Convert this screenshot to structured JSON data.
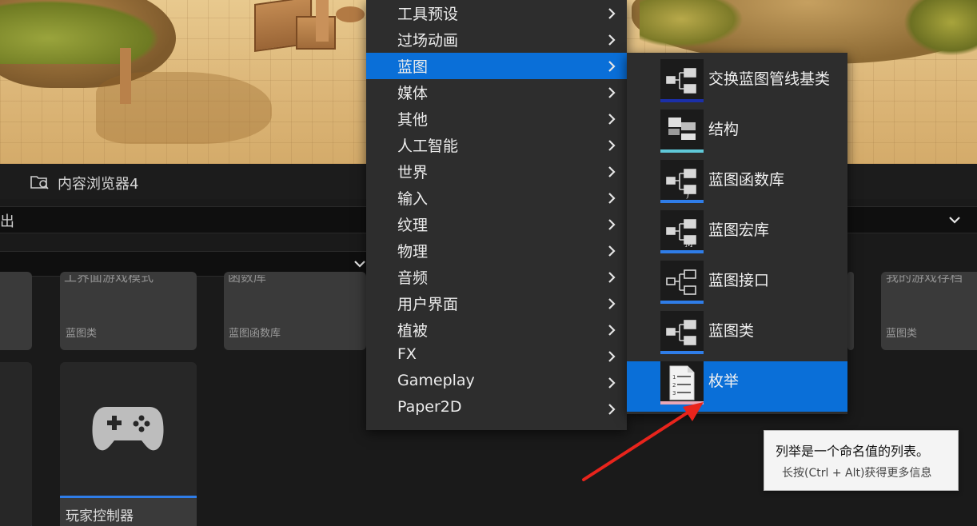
{
  "panel": {
    "tab_title": "内容浏览器4",
    "path_text": "出"
  },
  "assets": {
    "row1": [
      {
        "cut_name": "",
        "type_label": ""
      },
      {
        "cut_name": "工界面游戏模式",
        "type_label": "蓝图类"
      },
      {
        "cut_name": "函数库",
        "type_label": "蓝图函数库"
      },
      {
        "cut_name": "我的游戏存档",
        "type_label": "蓝图类"
      }
    ],
    "player_controller": {
      "name": "玩家控制器",
      "icon": "gamepad-icon"
    }
  },
  "menu": {
    "items": [
      {
        "label": "工具预设",
        "active": false
      },
      {
        "label": "过场动画",
        "active": false
      },
      {
        "label": "蓝图",
        "active": true
      },
      {
        "label": "媒体",
        "active": false
      },
      {
        "label": "其他",
        "active": false
      },
      {
        "label": "人工智能",
        "active": false
      },
      {
        "label": "世界",
        "active": false
      },
      {
        "label": "输入",
        "active": false
      },
      {
        "label": "纹理",
        "active": false
      },
      {
        "label": "物理",
        "active": false
      },
      {
        "label": "音频",
        "active": false
      },
      {
        "label": "用户界面",
        "active": false
      },
      {
        "label": "植被",
        "active": false
      },
      {
        "label": "FX",
        "active": false
      },
      {
        "label": "Gameplay",
        "active": false
      },
      {
        "label": "Paper2D",
        "active": false
      }
    ]
  },
  "submenu": {
    "items": [
      {
        "label": "交换蓝图管线基类",
        "icon": "blueprint-node-icon",
        "bar_color": "#1b2fa8",
        "active": false
      },
      {
        "label": "结构",
        "icon": "struct-icon",
        "bar_color": "#5fc8d8",
        "active": false
      },
      {
        "label": "蓝图函数库",
        "icon": "function-library-icon",
        "bar_color": "#2f7de8",
        "active": false
      },
      {
        "label": "蓝图宏库",
        "icon": "macro-library-icon",
        "bar_color": "#2f7de8",
        "active": false
      },
      {
        "label": "蓝图接口",
        "icon": "interface-icon",
        "bar_color": "#2f7de8",
        "active": false
      },
      {
        "label": "蓝图类",
        "icon": "blueprint-class-icon",
        "bar_color": "#2f7de8",
        "active": false
      },
      {
        "label": "枚举",
        "icon": "enum-icon",
        "bar_color": "#e8a8b8",
        "active": true
      }
    ]
  },
  "tooltip": {
    "title": "列举是一个命名值的列表。",
    "hint": "长按(Ctrl + Alt)获得更多信息"
  }
}
